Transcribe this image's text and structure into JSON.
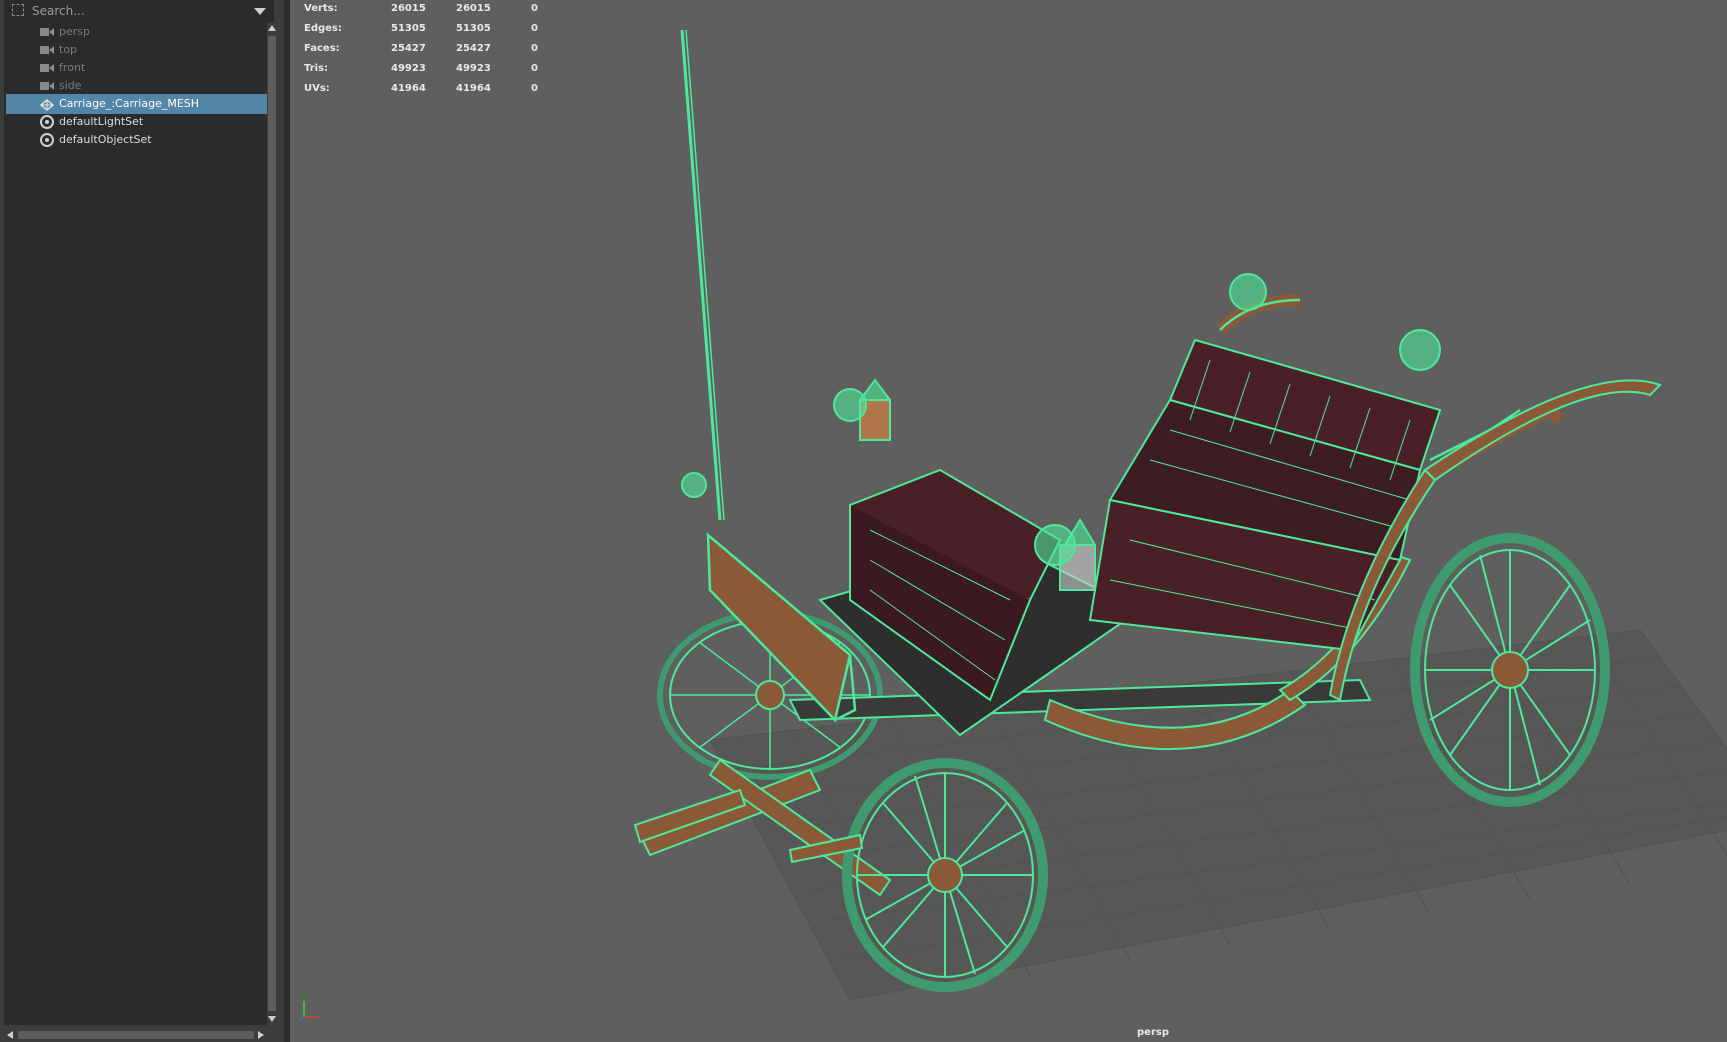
{
  "outliner": {
    "search_placeholder": "Search...",
    "items": [
      {
        "label": "persp",
        "icon": "camera-icon",
        "state": "dim"
      },
      {
        "label": "top",
        "icon": "camera-icon",
        "state": "dim"
      },
      {
        "label": "front",
        "icon": "camera-icon",
        "state": "dim"
      },
      {
        "label": "side",
        "icon": "camera-icon",
        "state": "dim"
      },
      {
        "label": "Carriage_:Carriage_MESH",
        "icon": "mesh-icon",
        "state": "selected"
      },
      {
        "label": "defaultLightSet",
        "icon": "set-icon",
        "state": "normal"
      },
      {
        "label": "defaultObjectSet",
        "icon": "set-icon",
        "state": "normal"
      }
    ]
  },
  "hud": {
    "rows": [
      {
        "label": "Verts:",
        "v1": "26015",
        "v2": "26015",
        "v3": "0"
      },
      {
        "label": "Edges:",
        "v1": "51305",
        "v2": "51305",
        "v3": "0"
      },
      {
        "label": "Faces:",
        "v1": "25427",
        "v2": "25427",
        "v3": "0"
      },
      {
        "label": "Tris:",
        "v1": "49923",
        "v2": "49923",
        "v3": "0"
      },
      {
        "label": "UVs:",
        "v1": "41964",
        "v2": "41964",
        "v3": "0"
      }
    ]
  },
  "viewport": {
    "camera_label": "persp"
  },
  "colors": {
    "selection": "#5285a6",
    "wireframe": "#4de89a",
    "wood": "#8a5a38",
    "leather": "#4a2028",
    "viewport_bg": "#5f5f5f"
  }
}
